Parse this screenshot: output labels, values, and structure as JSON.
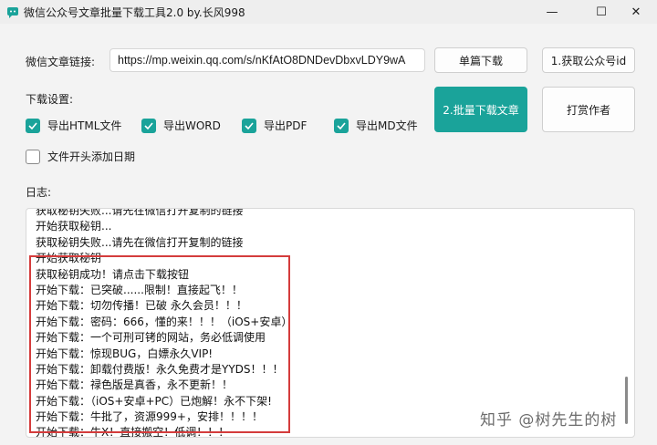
{
  "window": {
    "title": "微信公众号文章批量下载工具2.0 by.长风998",
    "min_glyph": "—",
    "max_glyph": "☐",
    "close_glyph": "✕"
  },
  "url_row": {
    "label": "微信文章链接:",
    "value": "https://mp.weixin.qq.com/s/nKfAtO8DNDevDbxvLDY9wA",
    "single_download": "单篇下载",
    "get_id": "1.获取公众号id"
  },
  "settings": {
    "label": "下载设置:",
    "options": [
      {
        "label": "导出HTML文件",
        "checked": true
      },
      {
        "label": "导出WORD",
        "checked": true
      },
      {
        "label": "导出PDF",
        "checked": true
      },
      {
        "label": "导出MD文件",
        "checked": true
      }
    ],
    "add_date": {
      "label": "文件开头添加日期",
      "checked": false
    },
    "batch_download": "2.批量下载文章",
    "tip_author": "打赏作者"
  },
  "log": {
    "label": "日志:",
    "lines": [
      "获取秘钥失败...请先在微信打开复制的链接",
      "开始获取秘钥...",
      "获取秘钥失败...请先在微信打开复制的链接",
      "开始获取秘钥",
      "获取秘钥成功！请点击下载按钮",
      "开始下载：已突破......限制！直接起飞！！",
      "开始下载：切勿传播！已破 永久会员！！！",
      "开始下载：密码：666，懂的来！！！（iOS+安卓）",
      "开始下载：一个可刑可铐的网站，务必低调使用",
      "开始下载：惊现BUG，白嫖永久VIP!",
      "开始下载：卸载付费版！永久免费才是YYDS！！！",
      "开始下载：禄色版是真香，永不更新！！",
      "开始下载：（iOS+安卓+PC）已炮解！永不下架!",
      "开始下载：牛批了，资源999+，安排！！！！",
      "开始下载：牛X！直接搬空！低调！！！"
    ]
  },
  "watermark": "知乎 @树先生的树",
  "colors": {
    "accent": "#1aa39a",
    "highlight": "#d43c3c"
  }
}
